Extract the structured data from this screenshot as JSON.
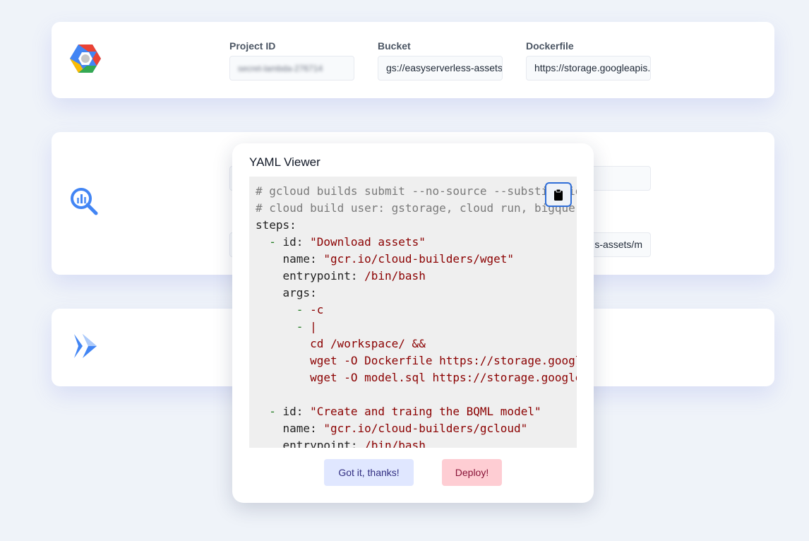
{
  "colors": {
    "background": "#eff3f9",
    "card": "#ffffff",
    "accent_blue": "#2f6ed8",
    "comment": "#7a7a7a",
    "yaml_dash": "#1e7a1e",
    "yaml_string": "#8b0000"
  },
  "cards": {
    "gcp": {
      "icon": "google-cloud-logo",
      "fields": [
        {
          "label": "Project ID",
          "value": "secret-lambda-276714",
          "blurred": true
        },
        {
          "label": "Bucket",
          "value": "gs://easyserverless-assets"
        },
        {
          "label": "Dockerfile",
          "value": "https://storage.googleapis.com"
        }
      ]
    },
    "bigquery": {
      "icon": "bigquery-icon",
      "partial_value": "s-assets/m"
    },
    "cloudrun": {
      "icon": "cloud-run-icon"
    }
  },
  "modal": {
    "title": "YAML Viewer",
    "copy_icon": "clipboard-icon",
    "lines": [
      [
        {
          "t": "# gcloud builds submit --no-source --substitutions",
          "c": "comment"
        }
      ],
      [
        {
          "t": "# cloud build user: gstorage, cloud run, bigquery",
          "c": "comment"
        }
      ],
      [
        {
          "t": "steps:",
          "c": "key"
        }
      ],
      [
        {
          "t": "  ",
          "c": "key"
        },
        {
          "t": "-",
          "c": "dash"
        },
        {
          "t": " id: ",
          "c": "key"
        },
        {
          "t": "\"Download assets\"",
          "c": "str"
        }
      ],
      [
        {
          "t": "    name: ",
          "c": "key"
        },
        {
          "t": "\"gcr.io/cloud-builders/wget\"",
          "c": "str"
        }
      ],
      [
        {
          "t": "    entrypoint: ",
          "c": "key"
        },
        {
          "t": "/bin/bash",
          "c": "str"
        }
      ],
      [
        {
          "t": "    args:",
          "c": "key"
        }
      ],
      [
        {
          "t": "      ",
          "c": "key"
        },
        {
          "t": "-",
          "c": "dash"
        },
        {
          "t": " -c",
          "c": "str"
        }
      ],
      [
        {
          "t": "      ",
          "c": "key"
        },
        {
          "t": "-",
          "c": "dash"
        },
        {
          "t": " |",
          "c": "str"
        }
      ],
      [
        {
          "t": "        cd /workspace/ &&",
          "c": "str"
        }
      ],
      [
        {
          "t": "        wget -O Dockerfile https://storage.googleapis.com",
          "c": "str"
        }
      ],
      [
        {
          "t": "        wget -O model.sql https://storage.googleapis.com",
          "c": "str"
        }
      ],
      [
        {
          "t": "",
          "c": "key"
        }
      ],
      [
        {
          "t": "  ",
          "c": "key"
        },
        {
          "t": "-",
          "c": "dash"
        },
        {
          "t": " id: ",
          "c": "key"
        },
        {
          "t": "\"Create and traing the BQML model\"",
          "c": "str"
        }
      ],
      [
        {
          "t": "    name: ",
          "c": "key"
        },
        {
          "t": "\"gcr.io/cloud-builders/gcloud\"",
          "c": "str"
        }
      ],
      [
        {
          "t": "    entrypoint: ",
          "c": "key"
        },
        {
          "t": "/bin/bash",
          "c": "str"
        }
      ]
    ],
    "buttons": {
      "got_it": "Got it, thanks!",
      "deploy": "Deploy!"
    }
  }
}
